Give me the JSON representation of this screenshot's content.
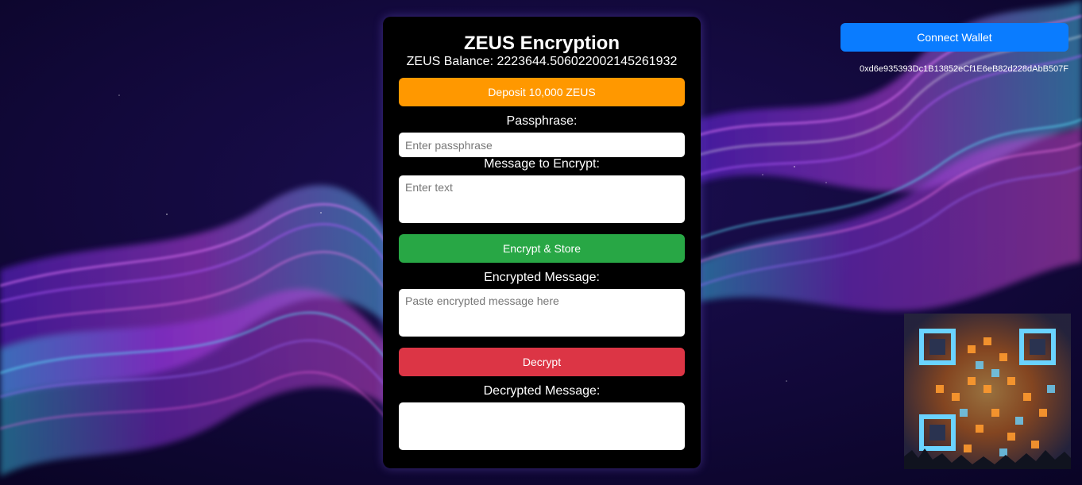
{
  "app": {
    "title": "ZEUS Encryption",
    "balance_text": "ZEUS Balance: 2223644.506022002145261932"
  },
  "buttons": {
    "deposit": "Deposit 10,000 ZEUS",
    "encrypt": "Encrypt & Store",
    "decrypt": "Decrypt",
    "connect_wallet": "Connect Wallet"
  },
  "fields": {
    "passphrase": {
      "label": "Passphrase:",
      "placeholder": "Enter passphrase",
      "value": ""
    },
    "message": {
      "label": "Message to Encrypt:",
      "placeholder": "Enter text",
      "value": ""
    },
    "encrypted": {
      "label": "Encrypted Message:",
      "placeholder": "Paste encrypted message here",
      "value": ""
    },
    "decrypted": {
      "label": "Decrypted Message:",
      "placeholder": "",
      "value": ""
    }
  },
  "wallet": {
    "address": "0xd6e935393Dc1B13852eCf1E6eB82d228dAbB507F"
  },
  "images": {
    "background": "purple-wave-background",
    "qr": "fiery-qr-code-art"
  },
  "colors": {
    "deposit": "#ff9800",
    "encrypt": "#28a745",
    "decrypt": "#dc3545",
    "connect": "#0a7cff",
    "panel": "#000000"
  }
}
